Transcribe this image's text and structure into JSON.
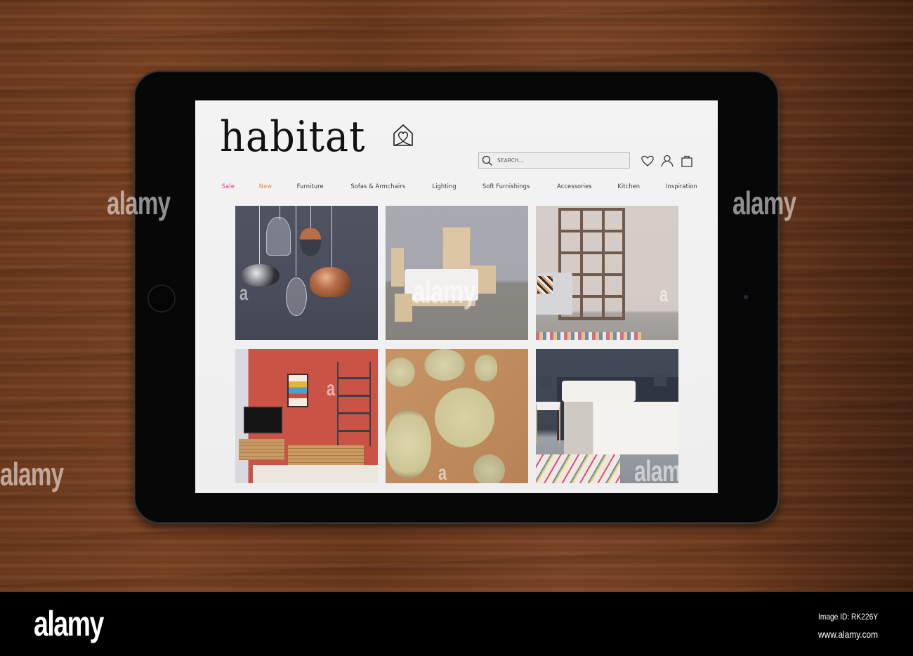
{
  "site": {
    "logo_text": "habitat",
    "logo_icon": "house-heart-icon"
  },
  "header": {
    "search": {
      "placeholder": "SEARCH...",
      "value": "",
      "icon": "search-icon"
    },
    "icons": [
      "heart-icon",
      "user-icon",
      "shopping-bag-icon"
    ]
  },
  "nav": {
    "items": [
      {
        "label": "Sale",
        "color": "#e0358a"
      },
      {
        "label": "New",
        "color": "#ec8a3c"
      },
      {
        "label": "Furniture",
        "color": "#3a3a3a"
      },
      {
        "label": "Sofas & Armchairs",
        "color": "#3a3a3a"
      },
      {
        "label": "Lighting",
        "color": "#3a3a3a"
      },
      {
        "label": "Soft Furnishings",
        "color": "#3a3a3a"
      },
      {
        "label": "Accessories",
        "color": "#3a3a3a"
      },
      {
        "label": "Kitchen",
        "color": "#3a3a3a"
      },
      {
        "label": "Inspiration",
        "color": "#3a3a3a"
      }
    ]
  },
  "tiles": [
    {
      "subject": "Pendant lights"
    },
    {
      "subject": "Bedroom furniture"
    },
    {
      "subject": "Shelving and sofa"
    },
    {
      "subject": "Living room with red wall"
    },
    {
      "subject": "Ceramic plates and bowls"
    },
    {
      "subject": "Bed with white linen"
    }
  ],
  "watermark": {
    "text": "alamy",
    "letter": "a"
  },
  "footer": {
    "brand": "alamy",
    "image_id": "Image ID: RK226Y",
    "url": "www.alamy.com"
  }
}
